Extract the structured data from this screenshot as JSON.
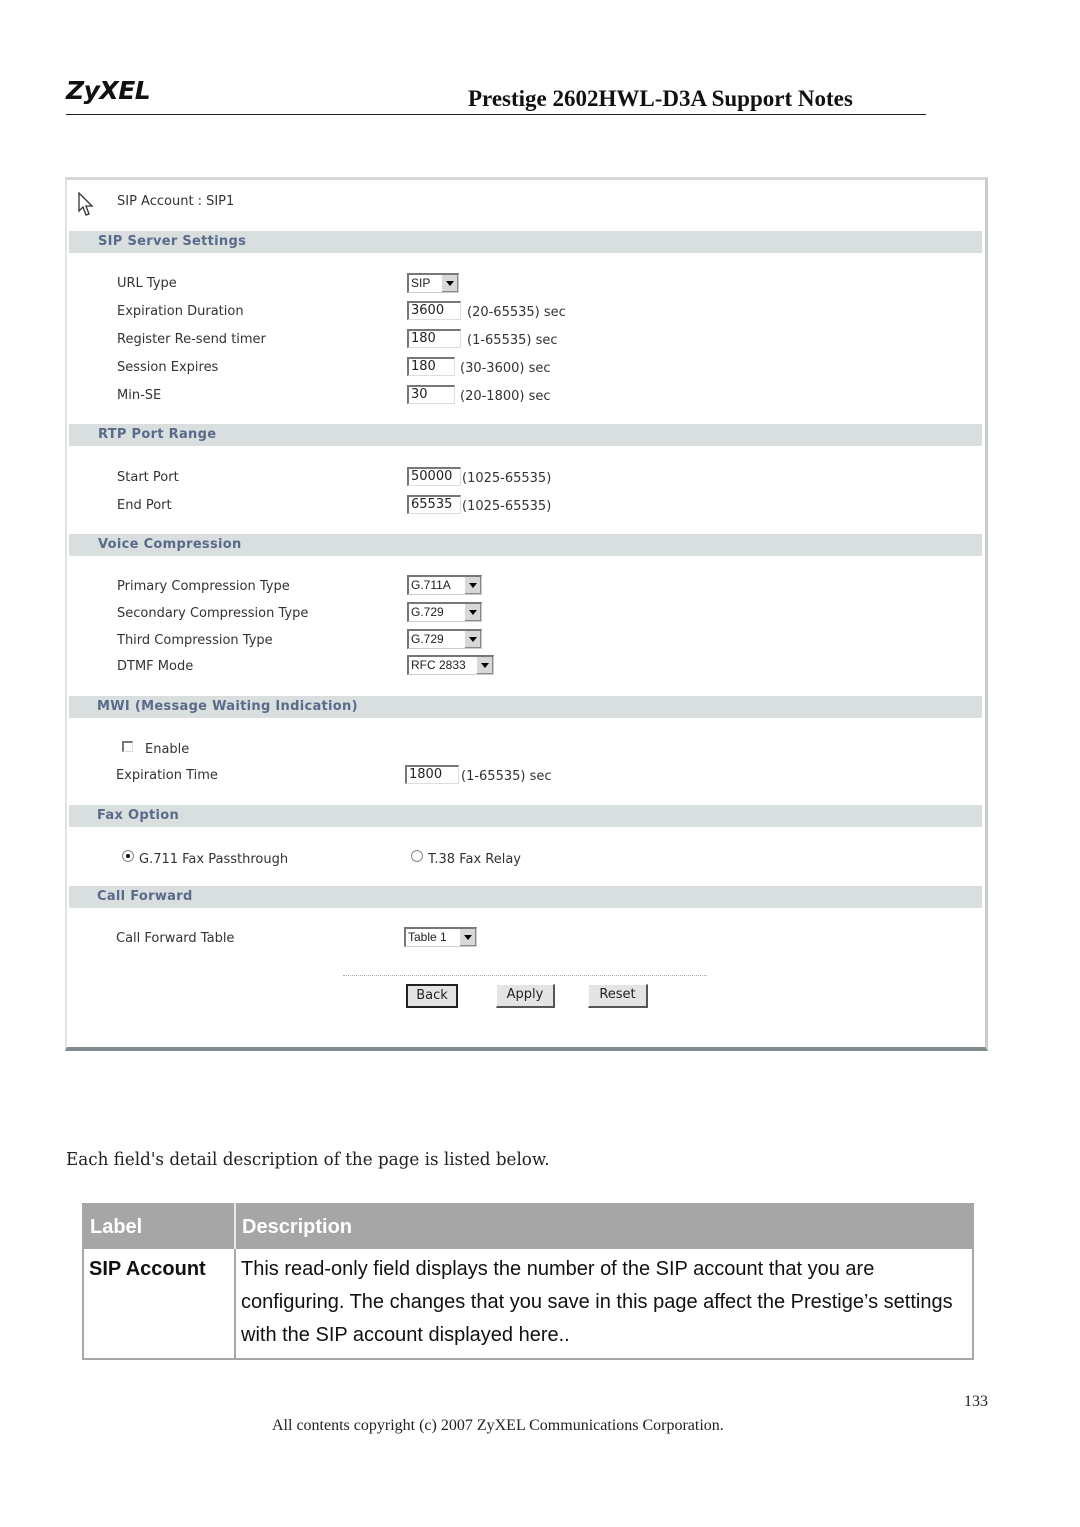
{
  "header": {
    "logo": "ZyXEL",
    "title": "Prestige 2602HWL-D3A Support Notes"
  },
  "screenshot": {
    "cursor_icon": "mouse-pointer-icon",
    "account_label": "SIP Account :",
    "account_value": "SIP1",
    "sections": {
      "sip_server": {
        "title": "SIP Server Settings",
        "url_type": {
          "label": "URL Type",
          "value": "SIP"
        },
        "expiration_duration": {
          "label": "Expiration Duration",
          "value": "3600",
          "range": "(20-65535) sec"
        },
        "register_resend": {
          "label": "Register Re-send timer",
          "value": "180",
          "range": "(1-65535) sec"
        },
        "session_expires": {
          "label": "Session Expires",
          "value": "180",
          "range": "(30-3600) sec"
        },
        "min_se": {
          "label": "Min-SE",
          "value": "30",
          "range": "(20-1800) sec"
        }
      },
      "rtp": {
        "title": "RTP Port Range",
        "start_port": {
          "label": "Start Port",
          "value": "50000",
          "range": "(1025-65535)"
        },
        "end_port": {
          "label": "End Port",
          "value": "65535",
          "range": "(1025-65535)"
        }
      },
      "voice": {
        "title": "Voice Compression",
        "primary": {
          "label": "Primary Compression Type",
          "value": "G.711A"
        },
        "secondary": {
          "label": "Secondary Compression Type",
          "value": "G.729"
        },
        "third": {
          "label": "Third Compression Type",
          "value": "G.729"
        },
        "dtmf": {
          "label": "DTMF Mode",
          "value": "RFC 2833"
        }
      },
      "mwi": {
        "title": "MWI (Message Waiting Indication)",
        "enable": {
          "label": "Enable",
          "checked": false
        },
        "expiration_time": {
          "label": "Expiration Time",
          "value": "1800",
          "range": "(1-65535) sec"
        }
      },
      "fax": {
        "title": "Fax Option",
        "g711": {
          "label": "G.711 Fax Passthrough",
          "selected": true
        },
        "t38": {
          "label": "T.38 Fax Relay",
          "selected": false
        }
      },
      "call_forward": {
        "title": "Call Forward",
        "table": {
          "label": "Call Forward Table",
          "value": "Table 1"
        }
      }
    },
    "buttons": {
      "back": "Back",
      "apply": "Apply",
      "reset": "Reset"
    }
  },
  "intro": "Each field's detail description of the page is listed below.",
  "table": {
    "headers": [
      "Label",
      "Description"
    ],
    "rows": [
      {
        "label": "SIP Account",
        "description": "This read-only field displays the number of the SIP account that you are configuring. The changes that you save in this page affect the Prestige’s settings with the SIP account displayed here.."
      }
    ]
  },
  "footer": {
    "page_number": "133",
    "copyright": "All contents copyright (c) 2007 ZyXEL Communications Corporation."
  }
}
